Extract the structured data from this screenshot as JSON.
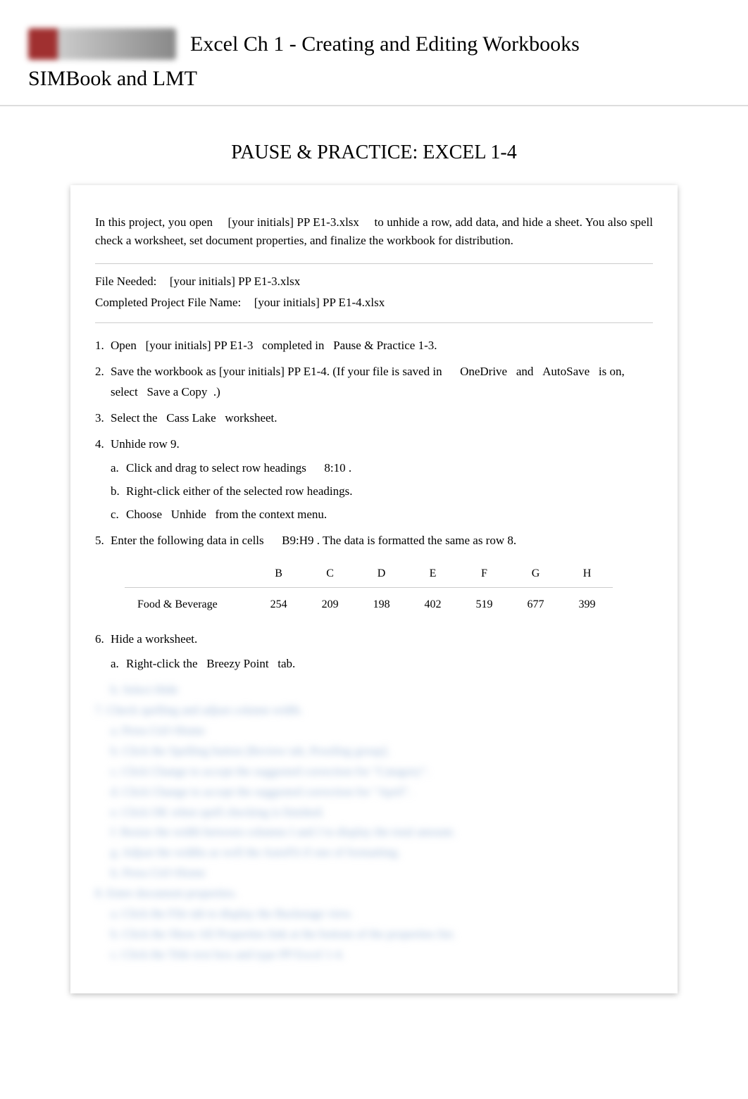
{
  "header": {
    "title": "Excel Ch 1 - Creating and Editing Workbooks",
    "subtitle": "SIMBook and LMT"
  },
  "section_title": "PAUSE & PRACTICE: EXCEL 1-4",
  "intro": "In this project, you open  [your initials] PP E1-3.xlsx  to unhide a row, add data, and hide a sheet. You also spell check a worksheet, set document properties, and finalize the workbook for distribution.",
  "files": {
    "needed_label": "File Needed:",
    "needed_value": "[your initials] PP E1-3.xlsx",
    "completed_label": "Completed Project File Name:",
    "completed_value": "[your initials] PP E1-4.xlsx"
  },
  "steps": [
    {
      "text": "Open  [your initials] PP E1-3  completed in  Pause & Practice 1-3."
    },
    {
      "text": "Save the workbook as [your initials] PP E1-4. (If your file is saved in   OneDrive  and  AutoSave  is on, select  Save a Copy .)"
    },
    {
      "text": "Select the  Cass Lake  worksheet."
    },
    {
      "text": "Unhide row 9.",
      "sub": [
        "Click and drag to select row headings   8:10 .",
        "Right-click either of the selected row headings.",
        "Choose  Unhide  from the context menu."
      ]
    },
    {
      "text": "Enter the following data in cells   B9:H9 . The data is formatted the same as row 8.",
      "table": true
    },
    {
      "text": "Hide a worksheet.",
      "sub": [
        "Right-click the  Breezy Point  tab."
      ]
    }
  ],
  "table": {
    "headers": [
      "",
      "B",
      "C",
      "D",
      "E",
      "F",
      "G",
      "H"
    ],
    "row_label": "Food & Beverage",
    "values": [
      "254",
      "209",
      "198",
      "402",
      "519",
      "677",
      "399"
    ]
  },
  "blurred_lines": [
    "b. Select  Hide",
    "7. Check spelling and adjust column width.",
    "a. Press  Ctrl+Home",
    "b. Click the  Spelling  button [Review tab, Proofing group].",
    "c. Click Change  to accept the suggested correction for \"Catagory\".",
    "d. Click Change  to accept the suggested correction for \"April\".",
    "e. Click OK when spell checking is finished.",
    "f. Resize the width between columns I and J to display the total amount.",
    "g. Adjust the widths as well the AutoFit if one of formatting.",
    "h. Press  Ctrl+Home",
    "8. Enter document properties.",
    "a. Click the  File tab to display the  Backstage  view.",
    "b. Click the  Show All Properties  link at the bottom of the properties list.",
    "c. Click the  Title text box and type PP Excel 1-4."
  ]
}
